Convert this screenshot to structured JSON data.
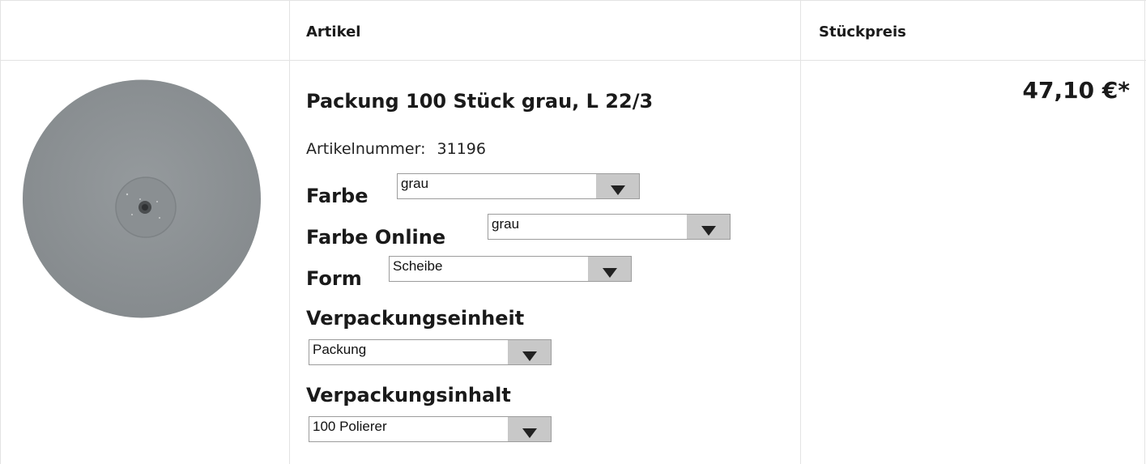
{
  "header": {
    "col_article": "Artikel",
    "col_price": "Stückpreis"
  },
  "product": {
    "title": "Packung 100 Stück grau, L 22/3",
    "article_number_label": "Artikelnummer:",
    "article_number": "31196",
    "price": "47,10 €*",
    "image_icon": "grey-polishing-disc-image"
  },
  "options": {
    "farbe": {
      "label": "Farbe",
      "value": "grau"
    },
    "farbe_online": {
      "label": "Farbe Online",
      "value": "grau"
    },
    "form": {
      "label": "Form",
      "value": "Scheibe"
    },
    "verpackungseinheit": {
      "label": "Verpackungseinheit",
      "value": "Packung"
    },
    "verpackungsinhalt": {
      "label": "Verpackungsinhalt",
      "value": "100 Polierer"
    }
  },
  "colors": {
    "border": "#e3e3e3",
    "select_button": "#c8c8c8",
    "disc": "#8e9396"
  }
}
